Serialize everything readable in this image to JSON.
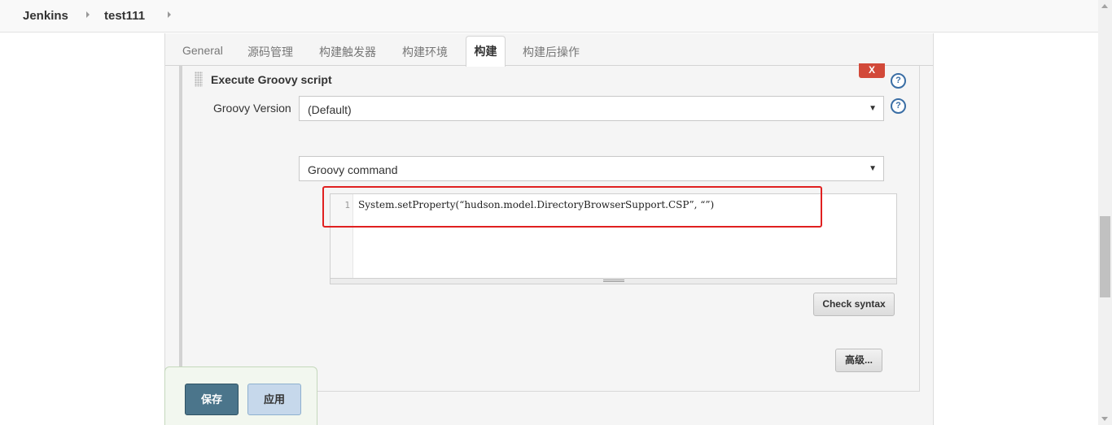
{
  "breadcrumb": {
    "items": [
      "Jenkins",
      "test111"
    ]
  },
  "tabs": [
    {
      "label": "General"
    },
    {
      "label": "源码管理"
    },
    {
      "label": "构建触发器"
    },
    {
      "label": "构建环境"
    },
    {
      "label": "构建",
      "active": true
    },
    {
      "label": "构建后操作"
    }
  ],
  "build_step": {
    "title": "Execute Groovy script",
    "delete_label": "X",
    "help_label": "?",
    "groovy_version": {
      "label": "Groovy Version",
      "selected": "(Default)"
    },
    "command_type": {
      "selected": "Groovy command"
    },
    "editor": {
      "line_number": "1",
      "code": "System.setProperty(“hudson.model.DirectoryBrowserSupport.CSP”, “”)"
    },
    "check_syntax_label": "Check syntax",
    "advanced_label": "高级..."
  },
  "footer": {
    "save_label": "保存",
    "apply_label": "应用"
  },
  "colors": {
    "highlight": "#e02020",
    "save_button": "#4b758b",
    "apply_button": "#c6d8eb",
    "delete_button": "#d24939",
    "help_icon": "#3a6ea5"
  }
}
